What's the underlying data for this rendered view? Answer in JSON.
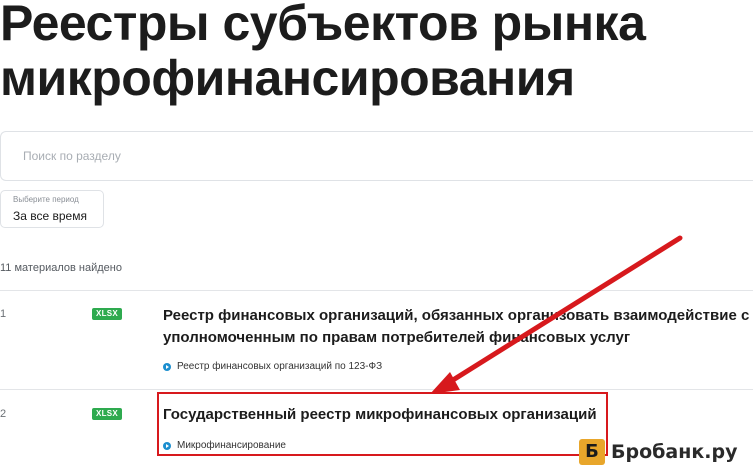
{
  "page": {
    "title": "Реестры субъектов рынка микрофинансирования"
  },
  "search": {
    "placeholder": "Поиск по разделу"
  },
  "period": {
    "label": "Выберите период",
    "value": "За все время"
  },
  "results": {
    "count_text": "11 материалов найдено",
    "items": [
      {
        "number": "1",
        "format": "XLSX",
        "title": "Реестр финансовых организаций, обязанных организовать взаимодействие с уполномоченным по правам потребителей финансовых услуг",
        "tag": "Реестр финансовых организаций по 123-ФЗ"
      },
      {
        "number": "2",
        "format": "XLSX",
        "title": "Государственный реестр микрофинансовых организаций",
        "tag": "Микрофинансирование"
      }
    ]
  },
  "annotation": {
    "color": "#d7191d"
  },
  "watermark": {
    "logo_letter": "Б",
    "text": "Бробанк.ру"
  },
  "colors": {
    "badge": "#2eaa4f",
    "tag_icon": "#1b8ecf",
    "highlight": "#d7191d",
    "watermark_logo": "#e8a62b"
  }
}
